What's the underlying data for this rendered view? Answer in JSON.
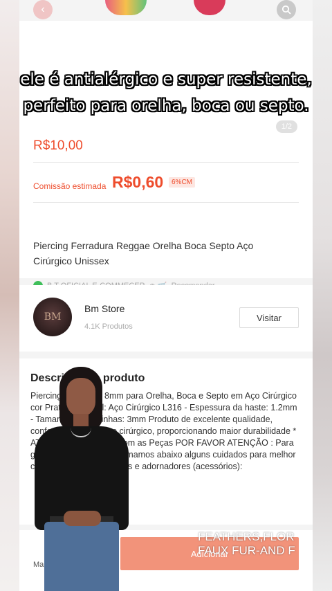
{
  "topbar": {
    "back_icon": "chevron-left-icon",
    "search_icon": "search-icon"
  },
  "product": {
    "image_counter": "1/2",
    "price": "R$10,00",
    "commission_label": "Comissão estimada",
    "commission_value": "R$0,60",
    "commission_badge": "6%CM",
    "title": "Piercing Ferradura Reggae Orelha Boca Septo Aço Cirúrgico Unissex",
    "seller_line": "B T OFICIAL E-COMMECER",
    "recommend_label": "Recomendar"
  },
  "store": {
    "avatar_text": "BM",
    "name": "Bm Store",
    "product_count": "4.1K Produtos",
    "visit_label": "Visitar"
  },
  "description": {
    "title": "Descrição do produto",
    "body": "Piercing Ferradura 8mm para Orelha, Boca e Septo em Aço Cirúrgico cor Prata - Material: Aço Cirúrgico L316 - Espessura da haste: 1.2mm - Tamanho das bolinhas: 3mm Produto de excelente qualidade, confeccionado em aço cirúrgico, proporcionando maior durabilidade * ATENÇÃO * Cuidados com as Peças POR FAVOR ATENÇÃO : Para garantir a qualidade informamos abaixo alguns cuidados para melhor conservação de suas joias e adornadores (acessórios):"
  },
  "bottom_bar": {
    "more_label": "Mais",
    "add_label": "Adicionar"
  },
  "overlay": {
    "subtitle": "ele é antialérgico e super resistente, perfeito para orelha, boca ou septo.",
    "caption_line1": "FEATHERS,FLOR",
    "caption_line2": "FAUX FUR-AND F"
  }
}
